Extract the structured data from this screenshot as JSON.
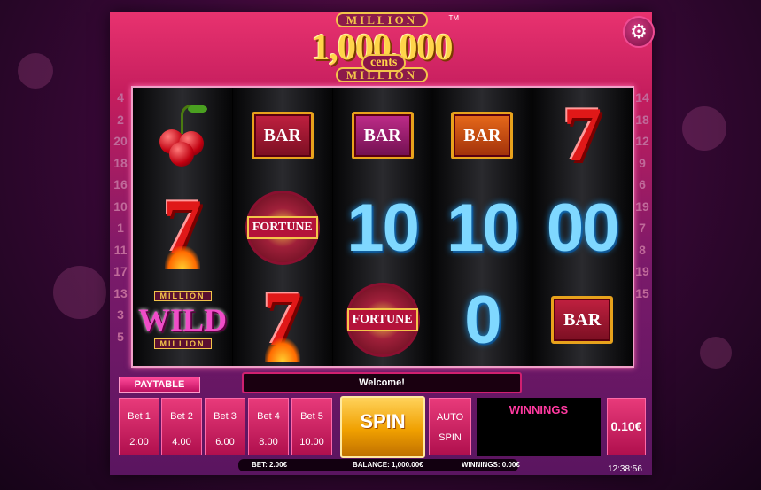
{
  "logo": {
    "top": "MILLION",
    "big": "1,000,000",
    "cents": "cents",
    "bottom": "MILLION",
    "tm": "TM"
  },
  "colors": {
    "accent": "#e8326f",
    "spin": "#f0a000",
    "winnings_label": "#ff3aa0"
  },
  "settings_icon": "gear-icon",
  "paylines_left": [
    "4",
    "2",
    "20",
    "18",
    "16",
    "10",
    "1",
    "11",
    "17",
    "13",
    "3",
    "5"
  ],
  "paylines_right": [
    "14",
    "18",
    "12",
    "9",
    "6",
    "19",
    "7",
    "8",
    "19",
    "15"
  ],
  "reels": [
    {
      "symbols": [
        "cherry",
        "seven-fire",
        "wild"
      ]
    },
    {
      "symbols": [
        "bar",
        "fortune",
        "seven-fire"
      ]
    },
    {
      "symbols": [
        "bar",
        "10",
        "fortune"
      ]
    },
    {
      "symbols": [
        "bar",
        "10",
        "0"
      ]
    },
    {
      "symbols": [
        "seven",
        "00",
        "bar"
      ]
    }
  ],
  "symbol_text": {
    "bar": "BAR",
    "fortune": "FORTUNE",
    "wild": "WILD",
    "wild_million": "MILLION"
  },
  "paytable_label": "PAYTABLE",
  "message": "Welcome!",
  "bets": [
    {
      "label": "Bet 1",
      "value": "2.00"
    },
    {
      "label": "Bet 2",
      "value": "4.00"
    },
    {
      "label": "Bet 3",
      "value": "6.00"
    },
    {
      "label": "Bet 4",
      "value": "8.00"
    },
    {
      "label": "Bet 5",
      "value": "10.00"
    }
  ],
  "spin_label": "SPIN",
  "auto_spin": {
    "line1": "AUTO",
    "line2": "SPIN"
  },
  "winnings_label": "WINNINGS",
  "coin_value": "0.10€",
  "status": {
    "bet": "BET: 2.00€",
    "balance": "BALANCE: 1,000.00€",
    "winnings": "WINNINGS: 0.00€"
  },
  "clock": "12:38:56"
}
